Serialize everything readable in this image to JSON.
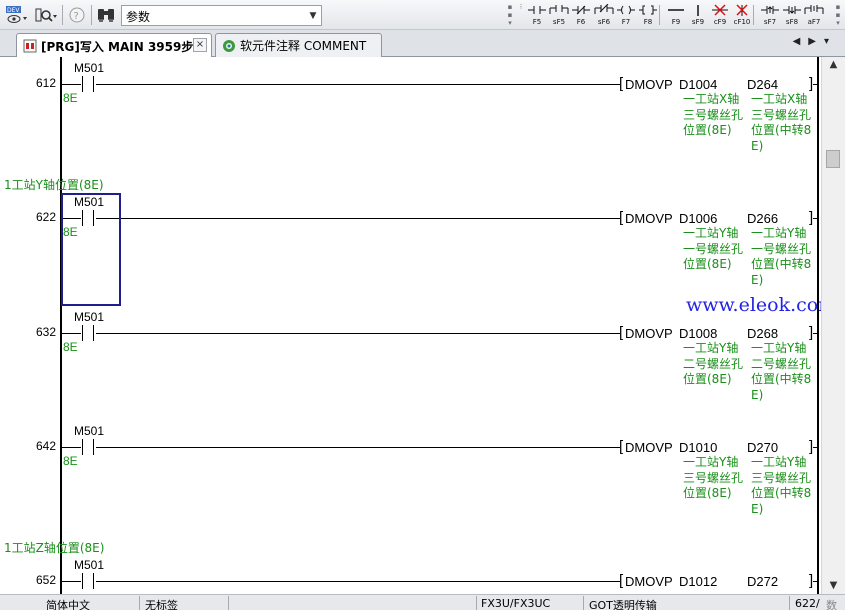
{
  "toolbar": {
    "combo_value": "参数",
    "fkeys": [
      {
        "label": "F5",
        "icon": "normally-open-contact-icon"
      },
      {
        "label": "sF5",
        "icon": "parallel-open-contact-icon"
      },
      {
        "label": "F6",
        "icon": "normally-closed-contact-icon"
      },
      {
        "label": "sF6",
        "icon": "parallel-closed-contact-icon"
      },
      {
        "label": "F7",
        "icon": "coil-icon"
      },
      {
        "label": "F8",
        "icon": "application-instruction-icon"
      },
      {
        "label": "F9",
        "icon": "horizontal-line-icon"
      },
      {
        "label": "sF9",
        "icon": "vertical-line-icon"
      },
      {
        "label": "cF9",
        "icon": "delete-horizontal-line-icon"
      },
      {
        "label": "cF10",
        "icon": "delete-vertical-line-icon"
      },
      {
        "label": "sF7",
        "icon": "rising-pulse-contact-icon"
      },
      {
        "label": "sF8",
        "icon": "falling-pulse-contact-icon"
      },
      {
        "label": "aF7",
        "icon": "parallel-rising-pulse-icon"
      }
    ]
  },
  "tabs": [
    {
      "label": "[PRG]写入 MAIN 3959步",
      "active": true
    },
    {
      "label": "软元件注释 COMMENT",
      "active": false
    }
  ],
  "statements": [
    "1工站Y轴位置(8E)",
    "1工站Z轴位置(8E)"
  ],
  "rungs": [
    {
      "step": "612",
      "contact": "M501",
      "contact_comment": "8E",
      "instruction": "DMOVP",
      "src": "D1004",
      "dst": "D264",
      "src_comment": "一工站X轴三号螺丝孔位置(8E)",
      "dst_comment": "一工站X轴三号螺丝孔位置(中转8E)"
    },
    {
      "step": "622",
      "contact": "M501",
      "contact_comment": "8E",
      "instruction": "DMOVP",
      "src": "D1006",
      "dst": "D266",
      "src_comment": "一工站Y轴一号螺丝孔位置(8E)",
      "dst_comment": "一工站Y轴一号螺丝孔位置(中转8E)"
    },
    {
      "step": "632",
      "contact": "M501",
      "contact_comment": "8E",
      "instruction": "DMOVP",
      "src": "D1008",
      "dst": "D268",
      "src_comment": "一工站Y轴二号螺丝孔位置(8E)",
      "dst_comment": "一工站Y轴二号螺丝孔位置(中转8E)"
    },
    {
      "step": "642",
      "contact": "M501",
      "contact_comment": "8E",
      "instruction": "DMOVP",
      "src": "D1010",
      "dst": "D270",
      "src_comment": "一工站Y轴三号螺丝孔位置(8E)",
      "dst_comment": "一工站Y轴三号螺丝孔位置(中转8E)"
    },
    {
      "step": "652",
      "contact": "M501",
      "contact_comment": "",
      "instruction": "DMOVP",
      "src": "D1012",
      "dst": "D272",
      "src_comment": "",
      "dst_comment": ""
    }
  ],
  "watermark": "www.eleok.com",
  "statusbar": {
    "language": "简体中文",
    "label": "无标签",
    "plc": "FX3U/FX3UC",
    "transfer": "GOT透明传输",
    "step": "622/",
    "extra": "数"
  },
  "colors": {
    "comment_green": "#1a8f1a",
    "cursor_blue": "#1e1e8e",
    "watermark_blue": "#2323e6"
  }
}
